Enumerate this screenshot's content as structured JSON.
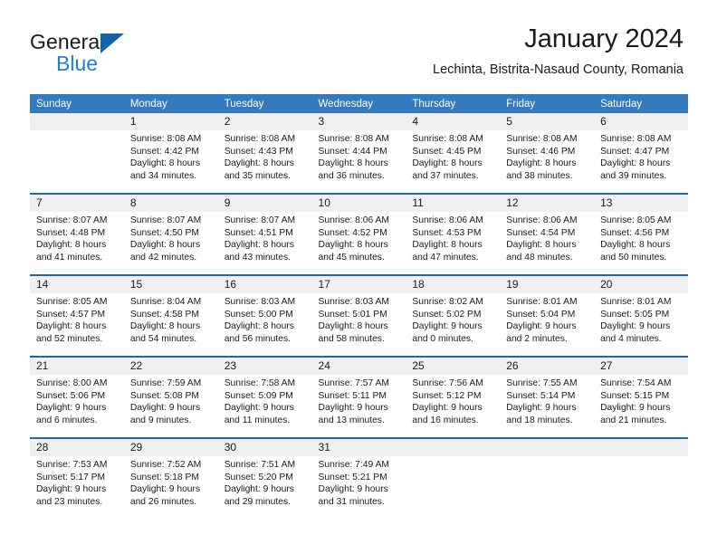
{
  "brand": {
    "name_top": "General",
    "name_bottom": "Blue",
    "triangle_color": "#1464ad",
    "blue_color": "#1e7fd4"
  },
  "header": {
    "title": "January 2024",
    "subtitle": "Lechinta, Bistrita-Nasaud County, Romania"
  },
  "theme": {
    "header_bg": "#3579bf",
    "week_rule": "#1f68b0",
    "daynum_bg": "#f0f0f0",
    "text": "#1a1a1a"
  },
  "calendar": {
    "weekday_headers": [
      "Sunday",
      "Monday",
      "Tuesday",
      "Wednesday",
      "Thursday",
      "Friday",
      "Saturday"
    ],
    "weeks": [
      [
        {
          "day": "",
          "sunrise": "",
          "sunset": "",
          "daylight": ""
        },
        {
          "day": "1",
          "sunrise": "Sunrise: 8:08 AM",
          "sunset": "Sunset: 4:42 PM",
          "daylight": "Daylight: 8 hours and 34 minutes."
        },
        {
          "day": "2",
          "sunrise": "Sunrise: 8:08 AM",
          "sunset": "Sunset: 4:43 PM",
          "daylight": "Daylight: 8 hours and 35 minutes."
        },
        {
          "day": "3",
          "sunrise": "Sunrise: 8:08 AM",
          "sunset": "Sunset: 4:44 PM",
          "daylight": "Daylight: 8 hours and 36 minutes."
        },
        {
          "day": "4",
          "sunrise": "Sunrise: 8:08 AM",
          "sunset": "Sunset: 4:45 PM",
          "daylight": "Daylight: 8 hours and 37 minutes."
        },
        {
          "day": "5",
          "sunrise": "Sunrise: 8:08 AM",
          "sunset": "Sunset: 4:46 PM",
          "daylight": "Daylight: 8 hours and 38 minutes."
        },
        {
          "day": "6",
          "sunrise": "Sunrise: 8:08 AM",
          "sunset": "Sunset: 4:47 PM",
          "daylight": "Daylight: 8 hours and 39 minutes."
        }
      ],
      [
        {
          "day": "7",
          "sunrise": "Sunrise: 8:07 AM",
          "sunset": "Sunset: 4:48 PM",
          "daylight": "Daylight: 8 hours and 41 minutes."
        },
        {
          "day": "8",
          "sunrise": "Sunrise: 8:07 AM",
          "sunset": "Sunset: 4:50 PM",
          "daylight": "Daylight: 8 hours and 42 minutes."
        },
        {
          "day": "9",
          "sunrise": "Sunrise: 8:07 AM",
          "sunset": "Sunset: 4:51 PM",
          "daylight": "Daylight: 8 hours and 43 minutes."
        },
        {
          "day": "10",
          "sunrise": "Sunrise: 8:06 AM",
          "sunset": "Sunset: 4:52 PM",
          "daylight": "Daylight: 8 hours and 45 minutes."
        },
        {
          "day": "11",
          "sunrise": "Sunrise: 8:06 AM",
          "sunset": "Sunset: 4:53 PM",
          "daylight": "Daylight: 8 hours and 47 minutes."
        },
        {
          "day": "12",
          "sunrise": "Sunrise: 8:06 AM",
          "sunset": "Sunset: 4:54 PM",
          "daylight": "Daylight: 8 hours and 48 minutes."
        },
        {
          "day": "13",
          "sunrise": "Sunrise: 8:05 AM",
          "sunset": "Sunset: 4:56 PM",
          "daylight": "Daylight: 8 hours and 50 minutes."
        }
      ],
      [
        {
          "day": "14",
          "sunrise": "Sunrise: 8:05 AM",
          "sunset": "Sunset: 4:57 PM",
          "daylight": "Daylight: 8 hours and 52 minutes."
        },
        {
          "day": "15",
          "sunrise": "Sunrise: 8:04 AM",
          "sunset": "Sunset: 4:58 PM",
          "daylight": "Daylight: 8 hours and 54 minutes."
        },
        {
          "day": "16",
          "sunrise": "Sunrise: 8:03 AM",
          "sunset": "Sunset: 5:00 PM",
          "daylight": "Daylight: 8 hours and 56 minutes."
        },
        {
          "day": "17",
          "sunrise": "Sunrise: 8:03 AM",
          "sunset": "Sunset: 5:01 PM",
          "daylight": "Daylight: 8 hours and 58 minutes."
        },
        {
          "day": "18",
          "sunrise": "Sunrise: 8:02 AM",
          "sunset": "Sunset: 5:02 PM",
          "daylight": "Daylight: 9 hours and 0 minutes."
        },
        {
          "day": "19",
          "sunrise": "Sunrise: 8:01 AM",
          "sunset": "Sunset: 5:04 PM",
          "daylight": "Daylight: 9 hours and 2 minutes."
        },
        {
          "day": "20",
          "sunrise": "Sunrise: 8:01 AM",
          "sunset": "Sunset: 5:05 PM",
          "daylight": "Daylight: 9 hours and 4 minutes."
        }
      ],
      [
        {
          "day": "21",
          "sunrise": "Sunrise: 8:00 AM",
          "sunset": "Sunset: 5:06 PM",
          "daylight": "Daylight: 9 hours and 6 minutes."
        },
        {
          "day": "22",
          "sunrise": "Sunrise: 7:59 AM",
          "sunset": "Sunset: 5:08 PM",
          "daylight": "Daylight: 9 hours and 9 minutes."
        },
        {
          "day": "23",
          "sunrise": "Sunrise: 7:58 AM",
          "sunset": "Sunset: 5:09 PM",
          "daylight": "Daylight: 9 hours and 11 minutes."
        },
        {
          "day": "24",
          "sunrise": "Sunrise: 7:57 AM",
          "sunset": "Sunset: 5:11 PM",
          "daylight": "Daylight: 9 hours and 13 minutes."
        },
        {
          "day": "25",
          "sunrise": "Sunrise: 7:56 AM",
          "sunset": "Sunset: 5:12 PM",
          "daylight": "Daylight: 9 hours and 16 minutes."
        },
        {
          "day": "26",
          "sunrise": "Sunrise: 7:55 AM",
          "sunset": "Sunset: 5:14 PM",
          "daylight": "Daylight: 9 hours and 18 minutes."
        },
        {
          "day": "27",
          "sunrise": "Sunrise: 7:54 AM",
          "sunset": "Sunset: 5:15 PM",
          "daylight": "Daylight: 9 hours and 21 minutes."
        }
      ],
      [
        {
          "day": "28",
          "sunrise": "Sunrise: 7:53 AM",
          "sunset": "Sunset: 5:17 PM",
          "daylight": "Daylight: 9 hours and 23 minutes."
        },
        {
          "day": "29",
          "sunrise": "Sunrise: 7:52 AM",
          "sunset": "Sunset: 5:18 PM",
          "daylight": "Daylight: 9 hours and 26 minutes."
        },
        {
          "day": "30",
          "sunrise": "Sunrise: 7:51 AM",
          "sunset": "Sunset: 5:20 PM",
          "daylight": "Daylight: 9 hours and 29 minutes."
        },
        {
          "day": "31",
          "sunrise": "Sunrise: 7:49 AM",
          "sunset": "Sunset: 5:21 PM",
          "daylight": "Daylight: 9 hours and 31 minutes."
        },
        {
          "day": "",
          "sunrise": "",
          "sunset": "",
          "daylight": ""
        },
        {
          "day": "",
          "sunrise": "",
          "sunset": "",
          "daylight": ""
        },
        {
          "day": "",
          "sunrise": "",
          "sunset": "",
          "daylight": ""
        }
      ]
    ]
  }
}
